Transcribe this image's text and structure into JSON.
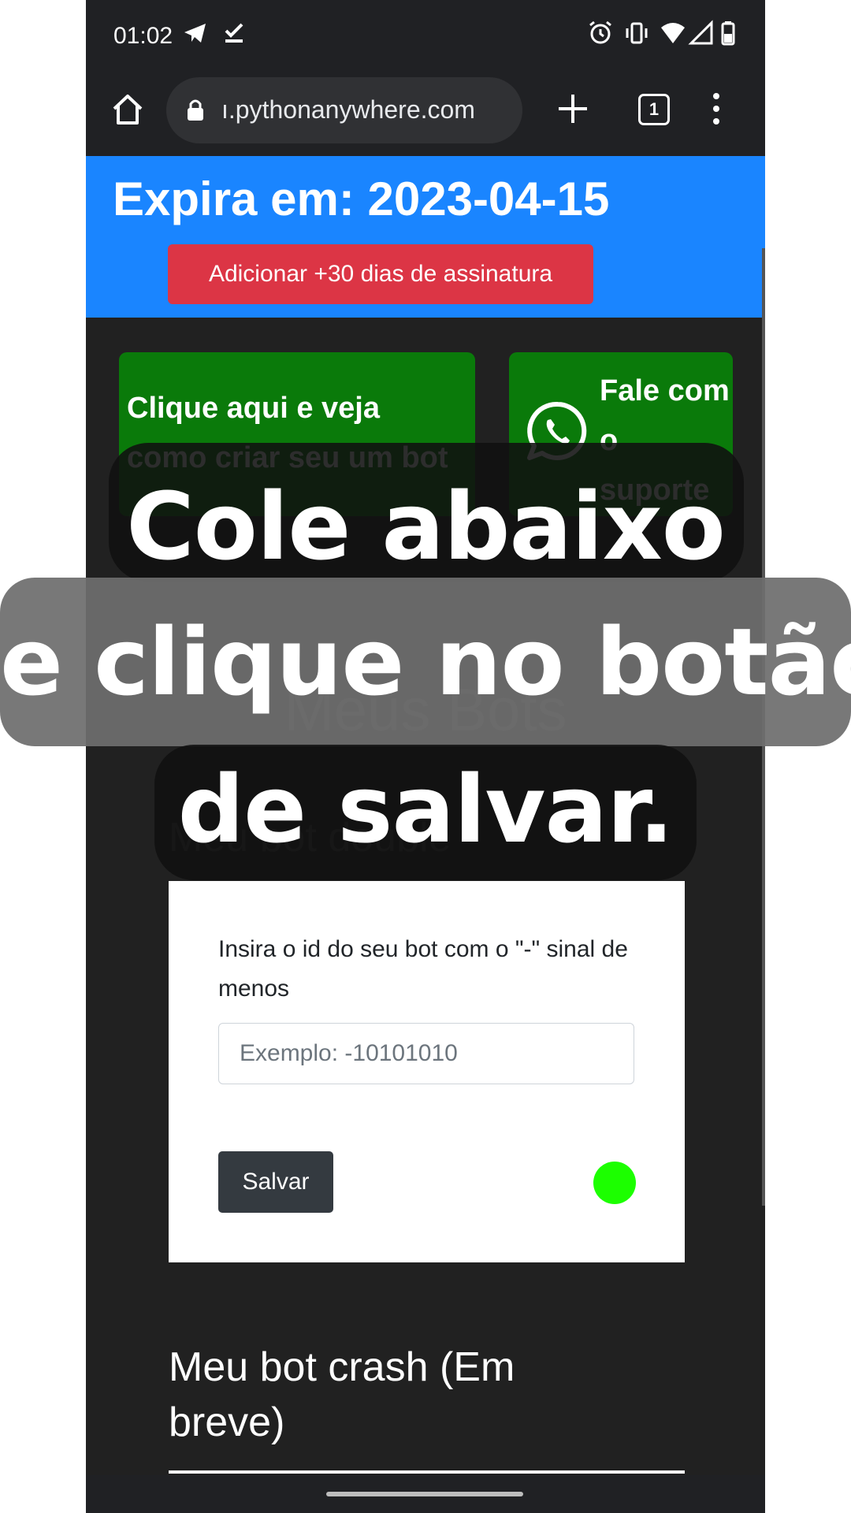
{
  "statusbar": {
    "time": "01:02",
    "left_icons": [
      "telegram-icon",
      "check-icon"
    ],
    "right_icons": [
      "alarm-icon",
      "vibrate-icon",
      "wifi-icon",
      "signal-icon",
      "battery-icon"
    ]
  },
  "browser": {
    "url": "ı.pythonanywhere.com",
    "tab_count": "1"
  },
  "banner": {
    "expire_text": "Expira em: 2023-04-15",
    "add_button": "Adicionar +30 dias de assinatura",
    "color": "#1a85ff"
  },
  "tutorial_button": {
    "line1": "Clique aqui e veja",
    "line2": "como criar seu um bot"
  },
  "support_button": {
    "label": "Fale com o suporte",
    "icon": "whatsapp-icon"
  },
  "main": {
    "section_title": "Meus Bots",
    "bot_double_title": "Meu bot double",
    "card": {
      "label": "Insira o id do seu bot com o \"-\" sinal de menos",
      "input_value": "",
      "input_placeholder": "Exemplo: -10101010",
      "save_label": "Salvar",
      "status_color": "#1cff00"
    },
    "bot_crash_title": "Meu bot crash (Em breve)"
  },
  "caption": {
    "line1": "Cole abaixo",
    "line2": "e clique no botão",
    "line3": "de salvar."
  }
}
